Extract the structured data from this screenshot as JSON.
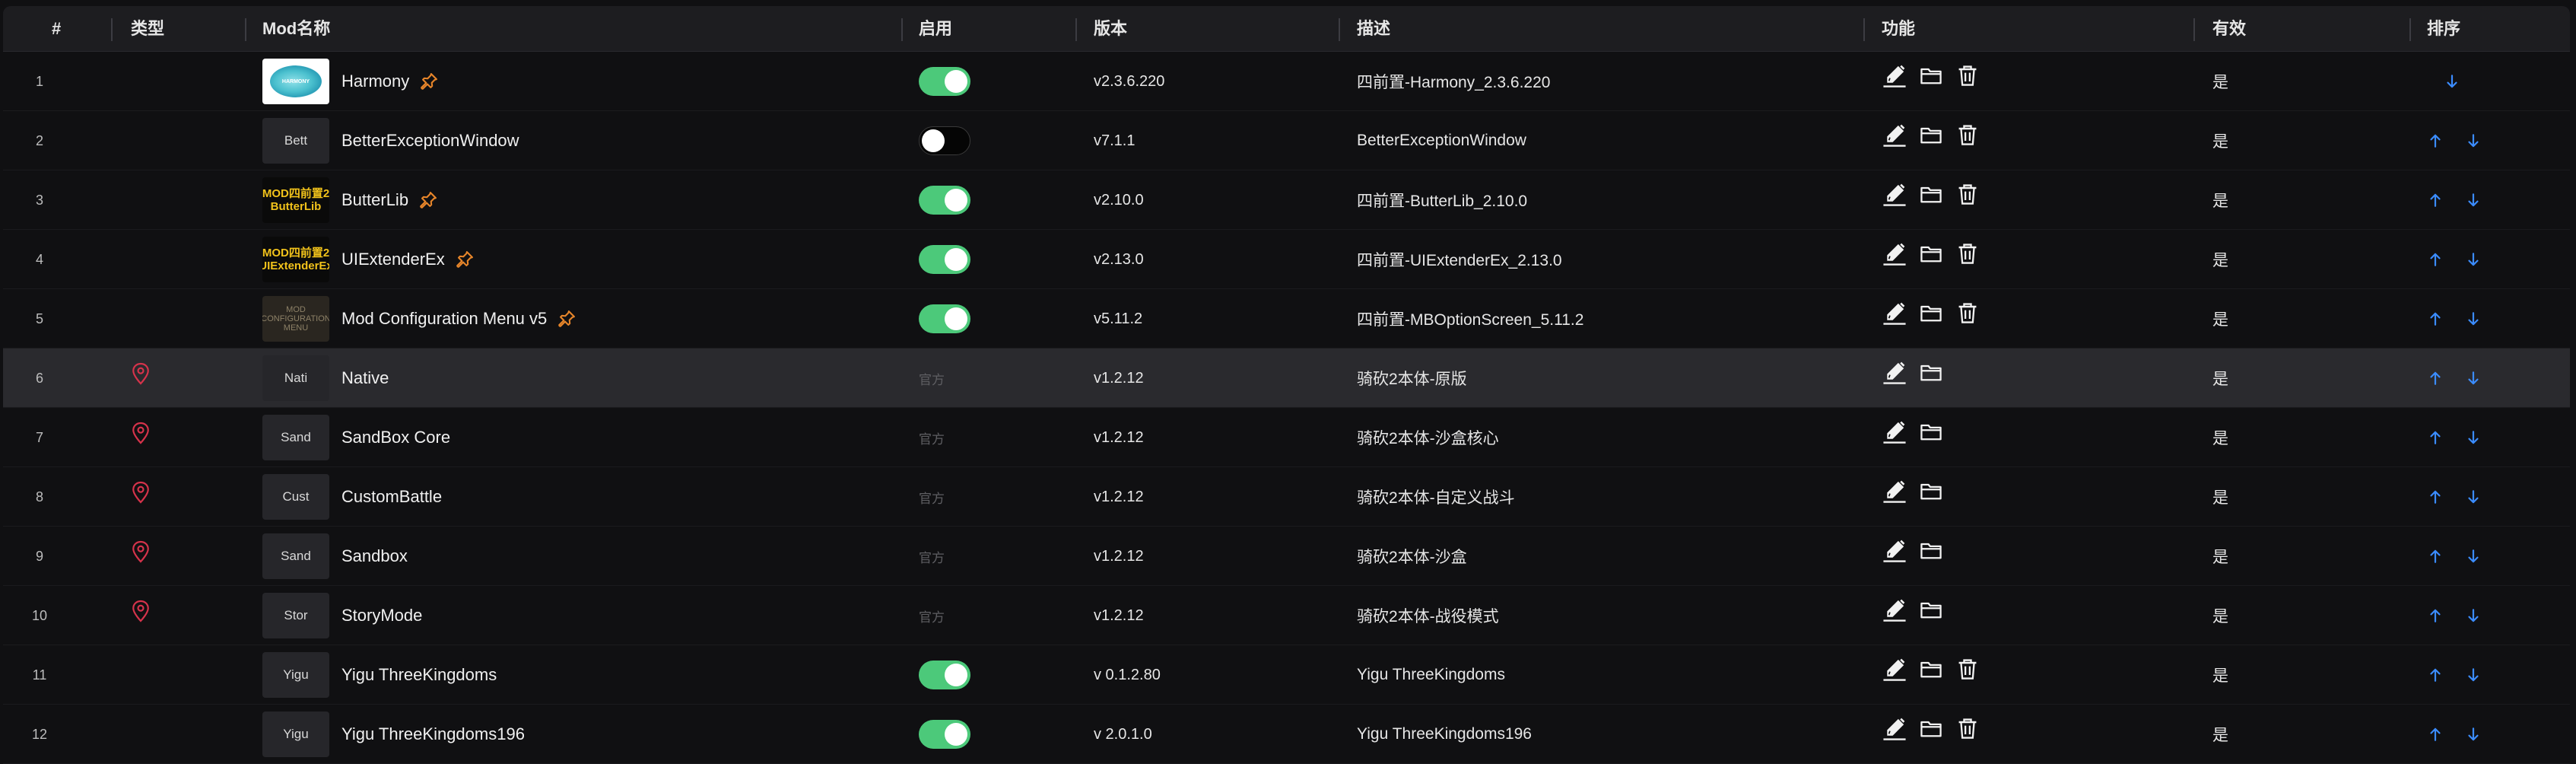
{
  "columns": {
    "num": "#",
    "type": "类型",
    "name": "Mod名称",
    "enable": "启用",
    "version": "版本",
    "desc": "描述",
    "func": "功能",
    "valid": "有效",
    "sort": "排序"
  },
  "colors": {
    "toggle_on": "#4cc97a",
    "pin": "#e8862a",
    "location": "#d6334b",
    "sort_arrow": "#3b8cff"
  },
  "rows": [
    {
      "num": "1",
      "thumb": "",
      "name": "Harmony",
      "pinned": true,
      "official_type": false,
      "enabled": true,
      "enable_text": "",
      "version": "v2.3.6.220",
      "desc": "四前置-Harmony_2.3.6.220",
      "delete": true,
      "valid": "是",
      "up": false,
      "down": true
    },
    {
      "num": "2",
      "thumb": "Bett",
      "name": "BetterExceptionWindow",
      "pinned": false,
      "official_type": false,
      "enabled": false,
      "enable_text": "",
      "version": "v7.1.1",
      "desc": "BetterExceptionWindow",
      "delete": true,
      "valid": "是",
      "up": true,
      "down": true
    },
    {
      "num": "3",
      "thumb": "",
      "name": "ButterLib",
      "pinned": true,
      "official_type": false,
      "enabled": true,
      "enable_text": "",
      "version": "v2.10.0",
      "desc": "四前置-ButterLib_2.10.0",
      "delete": true,
      "valid": "是",
      "up": true,
      "down": true
    },
    {
      "num": "4",
      "thumb": "",
      "name": "UIExtenderEx",
      "pinned": true,
      "official_type": false,
      "enabled": true,
      "enable_text": "",
      "version": "v2.13.0",
      "desc": "四前置-UIExtenderEx_2.13.0",
      "delete": true,
      "valid": "是",
      "up": true,
      "down": true
    },
    {
      "num": "5",
      "thumb": "",
      "name": "Mod Configuration Menu v5",
      "pinned": true,
      "official_type": false,
      "enabled": true,
      "enable_text": "",
      "version": "v5.11.2",
      "desc": "四前置-MBOptionScreen_5.11.2",
      "delete": true,
      "valid": "是",
      "up": true,
      "down": true
    },
    {
      "num": "6",
      "thumb": "Nati",
      "name": "Native",
      "pinned": false,
      "official_type": true,
      "enabled": null,
      "enable_text": "官方",
      "version": "v1.2.12",
      "desc": "骑砍2本体-原版",
      "delete": false,
      "valid": "是",
      "up": true,
      "down": true
    },
    {
      "num": "7",
      "thumb": "Sand",
      "name": "SandBox Core",
      "pinned": false,
      "official_type": true,
      "enabled": null,
      "enable_text": "官方",
      "version": "v1.2.12",
      "desc": "骑砍2本体-沙盒核心",
      "delete": false,
      "valid": "是",
      "up": true,
      "down": true
    },
    {
      "num": "8",
      "thumb": "Cust",
      "name": "CustomBattle",
      "pinned": false,
      "official_type": true,
      "enabled": null,
      "enable_text": "官方",
      "version": "v1.2.12",
      "desc": "骑砍2本体-自定义战斗",
      "delete": false,
      "valid": "是",
      "up": true,
      "down": true
    },
    {
      "num": "9",
      "thumb": "Sand",
      "name": "Sandbox",
      "pinned": false,
      "official_type": true,
      "enabled": null,
      "enable_text": "官方",
      "version": "v1.2.12",
      "desc": "骑砍2本体-沙盒",
      "delete": false,
      "valid": "是",
      "up": true,
      "down": true
    },
    {
      "num": "10",
      "thumb": "Stor",
      "name": "StoryMode",
      "pinned": false,
      "official_type": true,
      "enabled": null,
      "enable_text": "官方",
      "version": "v1.2.12",
      "desc": "骑砍2本体-战役模式",
      "delete": false,
      "valid": "是",
      "up": true,
      "down": true
    },
    {
      "num": "11",
      "thumb": "Yigu",
      "name": "Yigu ThreeKingdoms",
      "pinned": false,
      "official_type": false,
      "enabled": true,
      "enable_text": "",
      "version": "v 0.1.2.80",
      "desc": "Yigu ThreeKingdoms",
      "delete": true,
      "valid": "是",
      "up": true,
      "down": true
    },
    {
      "num": "12",
      "thumb": "Yigu",
      "name": "Yigu ThreeKingdoms196",
      "pinned": false,
      "official_type": false,
      "enabled": true,
      "enable_text": "",
      "version": "v 2.0.1.0",
      "desc": "Yigu ThreeKingdoms196",
      "delete": true,
      "valid": "是",
      "up": true,
      "down": true
    }
  ],
  "thumb_images": {
    "harmony": "HARMONY",
    "butterlib": [
      "MOD四前置2",
      "ButterLib"
    ],
    "uiextender": [
      "MOD四前置2",
      "UIExtenderEx"
    ],
    "mcm": [
      "MOD",
      "CONFIGURATION",
      "MENU"
    ]
  },
  "selected_row": "6"
}
